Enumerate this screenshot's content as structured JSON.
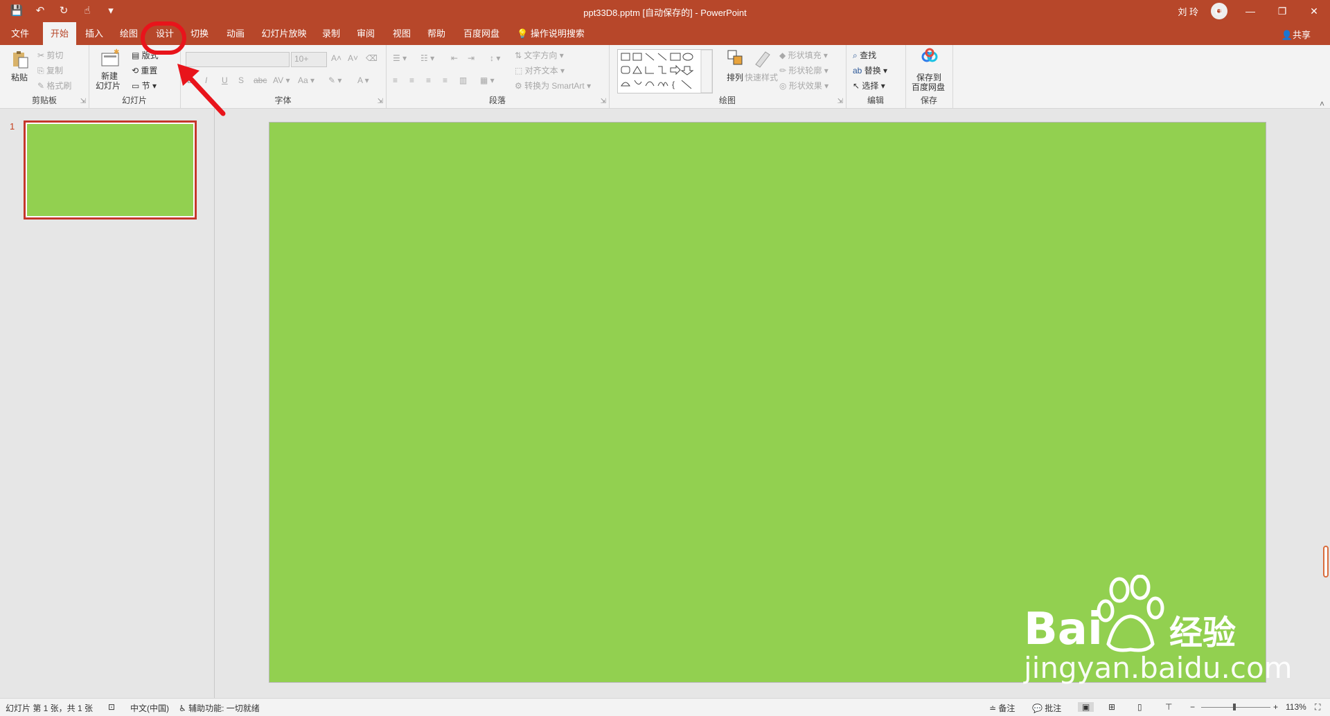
{
  "title_bar": {
    "doc_title": "ppt33D8.pptm [自动保存的] - PowerPoint",
    "user_name": "刘 玲",
    "qat": {
      "save": "💾",
      "undo": "↶",
      "redo": "↻",
      "touch": "☝",
      "more": "▾"
    },
    "win": {
      "ribbon_display": "⧉",
      "minimize": "—",
      "restore": "❐",
      "close": "✕"
    }
  },
  "tabs": [
    {
      "label": "文件"
    },
    {
      "label": "开始"
    },
    {
      "label": "插入"
    },
    {
      "label": "绘图"
    },
    {
      "label": "设计"
    },
    {
      "label": "切换"
    },
    {
      "label": "动画"
    },
    {
      "label": "幻灯片放映"
    },
    {
      "label": "录制"
    },
    {
      "label": "审阅"
    },
    {
      "label": "视图"
    },
    {
      "label": "帮助"
    },
    {
      "label": "百度网盘"
    }
  ],
  "tell_me": "操作说明搜索",
  "share": "共享",
  "ribbon": {
    "clipboard": {
      "label": "剪贴板",
      "paste": "粘贴",
      "cut": "剪切",
      "copy": "复制",
      "painter": "格式刷"
    },
    "slides": {
      "label": "幻灯片",
      "new_slide_1": "新建",
      "new_slide_2": "幻灯片",
      "layout": "版式",
      "reset": "重置",
      "section": "节"
    },
    "font": {
      "label": "字体",
      "size": "10+"
    },
    "paragraph": {
      "label": "段落",
      "text_direction": "文字方向",
      "align_text": "对齐文本",
      "smartart": "转换为 SmartArt"
    },
    "drawing": {
      "label": "绘图",
      "arrange": "排列",
      "quick_styles": "快速样式",
      "fill": "形状填充",
      "outline": "形状轮廓",
      "effects": "形状效果"
    },
    "editing": {
      "label": "编辑",
      "find": "查找",
      "replace": "替换",
      "select": "选择"
    },
    "save": {
      "label": "保存",
      "save_to_1": "保存到",
      "save_to_2": "百度网盘"
    }
  },
  "slides_panel": {
    "slide_number": "1"
  },
  "status": {
    "slide_info": "幻灯片 第 1 张，共 1 张",
    "language": "中文(中国)",
    "accessibility": "辅助功能: 一切就绪",
    "notes": "备注",
    "comments": "批注",
    "zoom": "113%"
  },
  "watermark": {
    "text": "jingyan.baidu.com",
    "logo_text": "Bai",
    "logo_cn": "经验"
  },
  "colors": {
    "brand": "#b7472a",
    "slide_bg": "#92d050",
    "annotation": "#e8141b"
  }
}
